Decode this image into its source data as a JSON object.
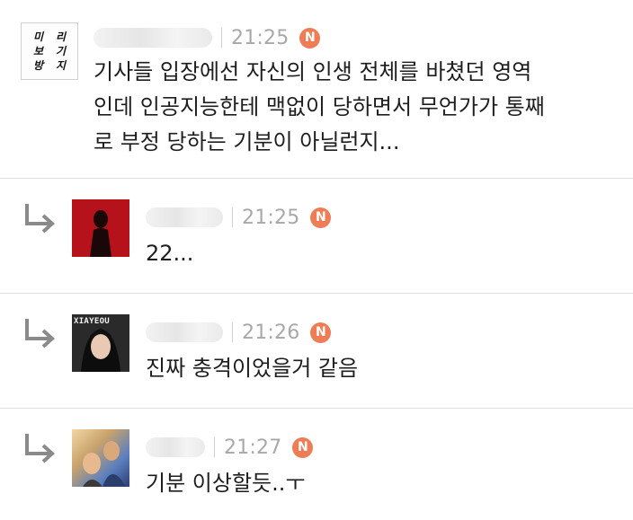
{
  "comments": [
    {
      "time": "21:25",
      "badge": "N",
      "avatar_lettering": [
        "미",
        "리",
        "보",
        "기",
        "방",
        "지"
      ],
      "text": "기사들 입장에선 자신의 인생 전체를 바쳤던 영역\n인데 인공지능한테 맥없이 당하면서 무언가가 통째\n로 부정 당하는 기분이 아닐런지..."
    },
    {
      "time": "21:25",
      "badge": "N",
      "text": "22..."
    },
    {
      "time": "21:26",
      "badge": "N",
      "avatar_caption": "XIAYEOU",
      "text": "진짜 충격이었을거 같음"
    },
    {
      "time": "21:27",
      "badge": "N",
      "text": "기분 이상할듯..ㅜ"
    }
  ],
  "colors": {
    "badge": "#ee7d55",
    "time": "#a8a8a8",
    "divider": "#dedede",
    "reply_arrow": "#8a8a8a"
  },
  "icons": {
    "reply": "reply-arrow-icon",
    "new_badge": "new-badge-icon"
  }
}
